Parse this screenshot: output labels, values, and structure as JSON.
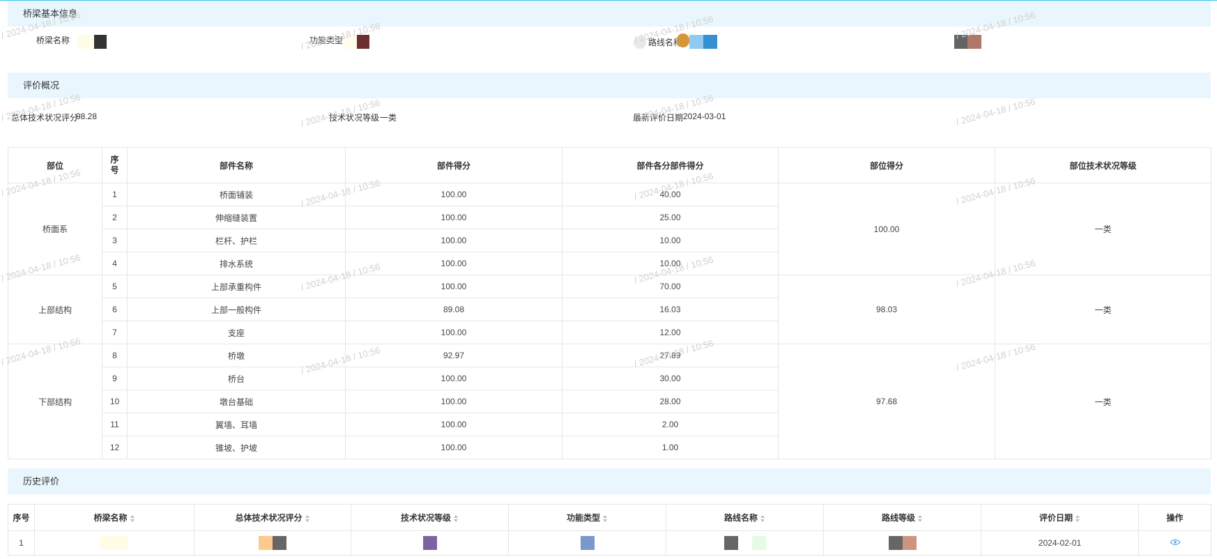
{
  "sections": {
    "basic_info": "桥梁基本信息",
    "evaluation": "评价概况",
    "history": "历史评价"
  },
  "basic_info": {
    "bridge_name_label": "桥梁名称",
    "function_type_label": "功能类型",
    "route_name_label": "路线名称"
  },
  "evaluation": {
    "total_score_label": "总体技术状况评分",
    "total_score_value": "98.28",
    "grade_label": "技术状况等级",
    "grade_value": "一类",
    "latest_date_label": "最新评价日期",
    "latest_date_value": "2024-03-01"
  },
  "watermark": "/ 2024-04-18 / 10:56",
  "main_table": {
    "headers": [
      "部位",
      "序号",
      "部件名称",
      "部件得分",
      "部件各分部件得分",
      "部位得分",
      "部位技术状况等级"
    ],
    "groups": [
      {
        "name": "桥面系",
        "position_score": "100.00",
        "grade": "一类",
        "rows": [
          {
            "no": "1",
            "name": "桥面铺装",
            "score": "100.00",
            "weighted": "40.00"
          },
          {
            "no": "2",
            "name": "伸缩缝装置",
            "score": "100.00",
            "weighted": "25.00"
          },
          {
            "no": "3",
            "name": "栏杆、护栏",
            "score": "100.00",
            "weighted": "10.00"
          },
          {
            "no": "4",
            "name": "排水系统",
            "score": "100.00",
            "weighted": "10.00"
          }
        ]
      },
      {
        "name": "上部结构",
        "position_score": "98.03",
        "grade": "一类",
        "rows": [
          {
            "no": "5",
            "name": "上部承重构件",
            "score": "100.00",
            "weighted": "70.00"
          },
          {
            "no": "6",
            "name": "上部一般构件",
            "score": "89.08",
            "weighted": "16.03"
          },
          {
            "no": "7",
            "name": "支座",
            "score": "100.00",
            "weighted": "12.00"
          }
        ]
      },
      {
        "name": "下部结构",
        "position_score": "97.68",
        "grade": "一类",
        "rows": [
          {
            "no": "8",
            "name": "桥墩",
            "score": "92.97",
            "weighted": "27.89"
          },
          {
            "no": "9",
            "name": "桥台",
            "score": "100.00",
            "weighted": "30.00"
          },
          {
            "no": "10",
            "name": "墩台基础",
            "score": "100.00",
            "weighted": "28.00"
          },
          {
            "no": "11",
            "name": "翼墙、耳墙",
            "score": "100.00",
            "weighted": "2.00"
          },
          {
            "no": "12",
            "name": "锥坡、护坡",
            "score": "100.00",
            "weighted": "1.00"
          }
        ]
      }
    ]
  },
  "history_table": {
    "headers": [
      "序号",
      "桥梁名称",
      "总体技术状况评分",
      "技术状况等级",
      "功能类型",
      "路线名称",
      "路线等级",
      "评价日期",
      "操作"
    ],
    "rows": [
      {
        "no": "1",
        "date": "2024-02-01"
      }
    ]
  },
  "icons": {
    "sort": "sort-icon",
    "view": "eye-icon"
  },
  "colors": {
    "section_bg": "#e9f6fd",
    "top_line": "#3ec3ef",
    "border": "#e6e6e6",
    "link": "#5aa7e8"
  }
}
